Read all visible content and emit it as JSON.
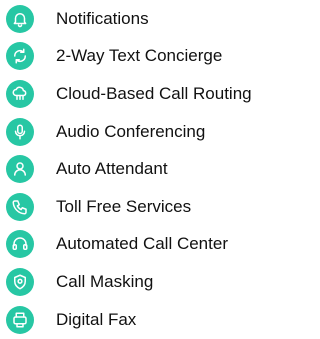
{
  "accent_color": "#27c7a4",
  "features": [
    {
      "label": "Notifications",
      "icon": "bell-icon"
    },
    {
      "label": "2-Way Text Concierge",
      "icon": "message-cycle-icon"
    },
    {
      "label": "Cloud-Based Call Routing",
      "icon": "cloud-network-icon"
    },
    {
      "label": "Audio Conferencing",
      "icon": "microphone-icon"
    },
    {
      "label": "Auto Attendant",
      "icon": "attendant-icon"
    },
    {
      "label": "Toll Free Services",
      "icon": "phone-icon"
    },
    {
      "label": "Automated Call Center",
      "icon": "headset-icon"
    },
    {
      "label": "Call Masking",
      "icon": "mask-icon"
    },
    {
      "label": "Digital Fax",
      "icon": "fax-icon"
    }
  ]
}
